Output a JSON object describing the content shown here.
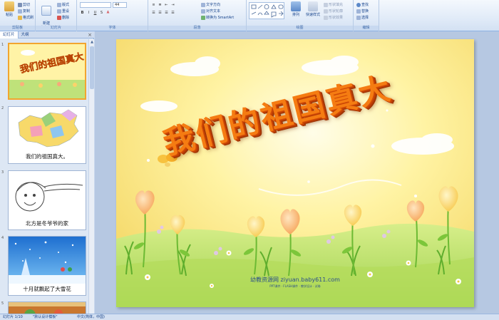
{
  "ribbon": {
    "clipboard": {
      "paste_label": "粘贴",
      "cut_label": "剪切",
      "copy_label": "复制",
      "painter_label": "格式刷",
      "group_label": "剪贴板"
    },
    "slides": {
      "new_slide_label": "新建\n幻灯片",
      "layout_label": "版式",
      "reset_label": "重设",
      "delete_label": "删除",
      "group_label": "幻灯片"
    },
    "font": {
      "font_name": "",
      "font_size": "44",
      "group_label": "字体"
    },
    "paragraph": {
      "text_direction_label": "文字方向",
      "align_text_label": "对齐文本",
      "smartart_label": "转换为 SmartArt",
      "group_label": "段落"
    },
    "drawing": {
      "arrange_label": "排列",
      "quick_styles_label": "快速样式",
      "shape_fill_label": "形状填充",
      "shape_outline_label": "形状轮廓",
      "shape_effects_label": "形状效果",
      "group_label": "绘图"
    },
    "editing": {
      "find_label": "查找",
      "replace_label": "替换",
      "select_label": "选择",
      "group_label": "编辑"
    }
  },
  "panel": {
    "tab_slides": "幻灯片",
    "tab_outline": "大纲",
    "close_glyph": "×",
    "thumbnails": [
      {
        "number": "1",
        "caption": ""
      },
      {
        "number": "2",
        "caption": "我们的祖国真大。"
      },
      {
        "number": "3",
        "caption": "北方是冬爷爷的家"
      },
      {
        "number": "4",
        "caption": "十月就飘起了大雪花"
      },
      {
        "number": "5",
        "caption": ""
      }
    ]
  },
  "slide": {
    "title": "我们的祖国真大",
    "watermark": "幼教资源网 ziyuan.baby611.com",
    "watermark_sub": "PPT课件 · FLASH课件 · 教学设计 · 试卷"
  },
  "status": {
    "slide_counter": "幻灯片 1/10",
    "theme": "\"默认设计模板\"",
    "language": "中文(简体，中国)"
  },
  "colors": {
    "ribbon_bg": "#dfe9f7",
    "title_orange": "#f57c12",
    "sky_yellow": "#fff6b0",
    "grass_green": "#8fd14f"
  }
}
